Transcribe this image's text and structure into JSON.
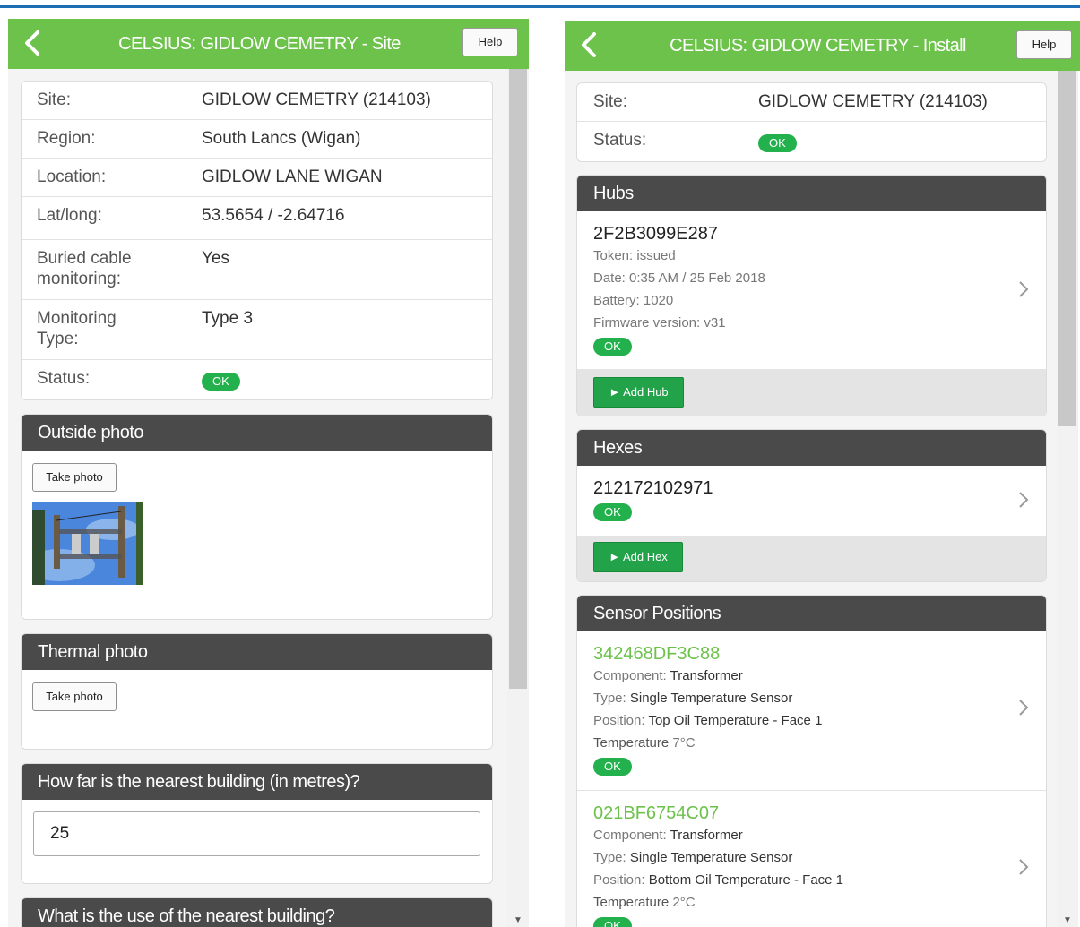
{
  "left": {
    "title": "CELSIUS: GIDLOW CEMETRY - Site",
    "help": "Help",
    "info": {
      "site_label": "Site:",
      "site_value": "GIDLOW CEMETRY (214103)",
      "region_label": "Region:",
      "region_value": "South Lancs (Wigan)",
      "location_label": "Location:",
      "location_value": "GIDLOW LANE WIGAN",
      "latlong_label": "Lat/long:",
      "latlong_value": "53.5654 / -2.64716",
      "buried_label_1": "Buried cable",
      "buried_label_2": "monitoring:",
      "buried_value": "Yes",
      "monitoring_label_1": "Monitoring",
      "monitoring_label_2": "Type:",
      "monitoring_value": "Type 3",
      "status_label": "Status:",
      "status_value": "OK"
    },
    "outside_photo": {
      "title": "Outside photo",
      "button": "Take photo"
    },
    "thermal_photo": {
      "title": "Thermal photo",
      "button": "Take photo"
    },
    "nearest_building": {
      "title": "How far is the nearest building (in metres)?",
      "value": "25"
    },
    "building_use": {
      "title": "What is the use of the nearest building?"
    }
  },
  "right": {
    "title": "CELSIUS: GIDLOW CEMETRY - Install",
    "help": "Help",
    "info": {
      "site_label": "Site:",
      "site_value": "GIDLOW CEMETRY (214103)",
      "status_label": "Status:",
      "status_value": "OK"
    },
    "hubs": {
      "title": "Hubs",
      "id": "2F2B3099E287",
      "token": "Token: issued",
      "date": "Date: 0:35 AM / 25 Feb 2018",
      "battery": "Battery: 1020",
      "firmware": "Firmware version: v31",
      "status": "OK",
      "add_button": "► Add Hub"
    },
    "hexes": {
      "title": "Hexes",
      "id": "212172102971",
      "status": "OK",
      "add_button": "► Add Hex"
    },
    "sensors": {
      "title": "Sensor Positions",
      "items": [
        {
          "id": "342468DF3C88",
          "component_label": "Component: ",
          "component_value": "Transformer",
          "type_label": "Type: ",
          "type_value": "Single Temperature Sensor",
          "position_label": "Position: ",
          "position_value": "Top Oil Temperature - Face 1",
          "temperature_label": "Temperature",
          "temperature_value": " 7°C",
          "status": "OK"
        },
        {
          "id": "021BF6754C07",
          "component_label": "Component: ",
          "component_value": "Transformer",
          "type_label": "Type: ",
          "type_value": "Single Temperature Sensor",
          "position_label": "Position: ",
          "position_value": "Bottom Oil Temperature - Face 1",
          "temperature_label": "Temperature",
          "temperature_value": " 2°C",
          "status": "OK"
        }
      ]
    }
  },
  "colors": {
    "appbar": "#6cc24a",
    "header": "#4a4a4a",
    "ok_badge": "#22b14c",
    "add_button": "#22a34a",
    "top_line": "#1c6fb4"
  }
}
